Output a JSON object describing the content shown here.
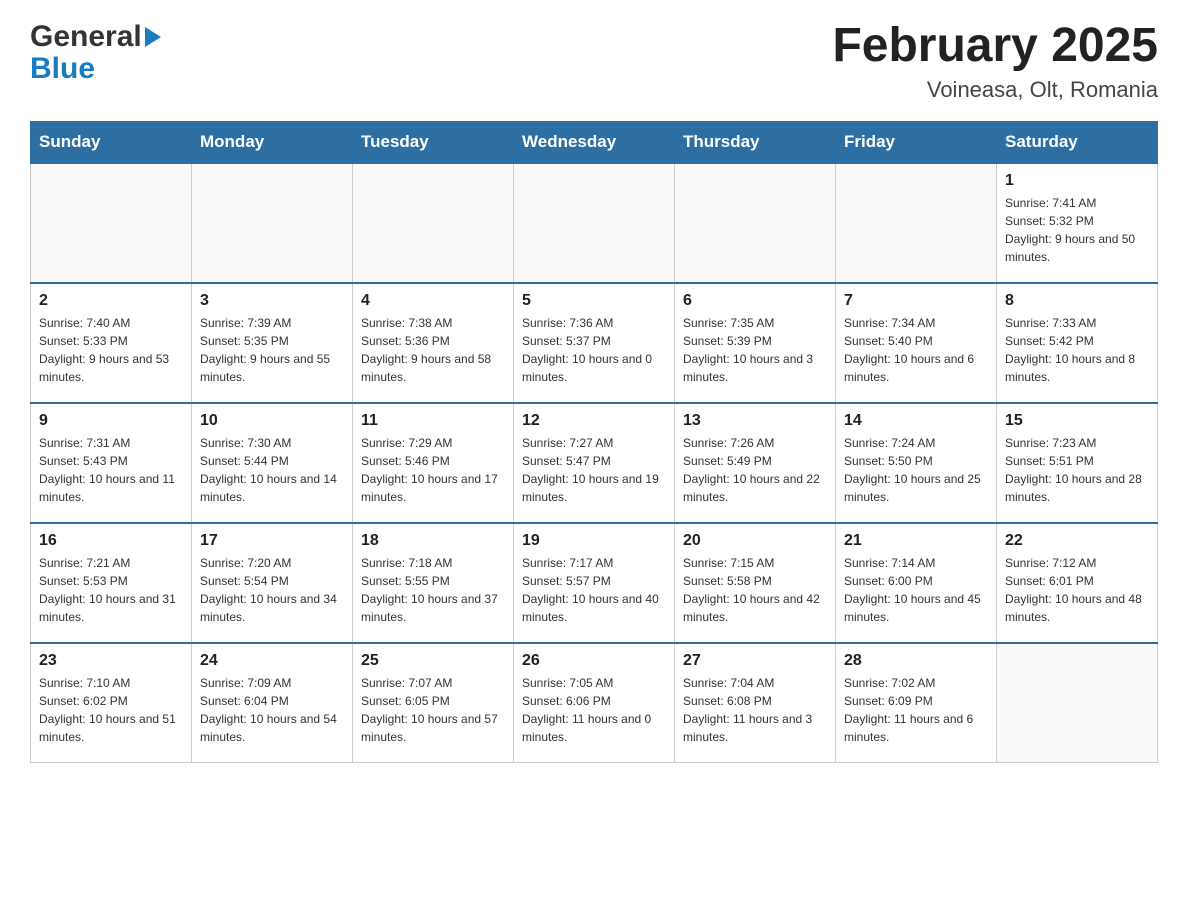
{
  "header": {
    "logo_general": "General",
    "logo_blue": "Blue",
    "title": "February 2025",
    "subtitle": "Voineasa, Olt, Romania"
  },
  "days_of_week": [
    "Sunday",
    "Monday",
    "Tuesday",
    "Wednesday",
    "Thursday",
    "Friday",
    "Saturday"
  ],
  "weeks": [
    [
      {
        "day": "",
        "info": ""
      },
      {
        "day": "",
        "info": ""
      },
      {
        "day": "",
        "info": ""
      },
      {
        "day": "",
        "info": ""
      },
      {
        "day": "",
        "info": ""
      },
      {
        "day": "",
        "info": ""
      },
      {
        "day": "1",
        "info": "Sunrise: 7:41 AM\nSunset: 5:32 PM\nDaylight: 9 hours and 50 minutes."
      }
    ],
    [
      {
        "day": "2",
        "info": "Sunrise: 7:40 AM\nSunset: 5:33 PM\nDaylight: 9 hours and 53 minutes."
      },
      {
        "day": "3",
        "info": "Sunrise: 7:39 AM\nSunset: 5:35 PM\nDaylight: 9 hours and 55 minutes."
      },
      {
        "day": "4",
        "info": "Sunrise: 7:38 AM\nSunset: 5:36 PM\nDaylight: 9 hours and 58 minutes."
      },
      {
        "day": "5",
        "info": "Sunrise: 7:36 AM\nSunset: 5:37 PM\nDaylight: 10 hours and 0 minutes."
      },
      {
        "day": "6",
        "info": "Sunrise: 7:35 AM\nSunset: 5:39 PM\nDaylight: 10 hours and 3 minutes."
      },
      {
        "day": "7",
        "info": "Sunrise: 7:34 AM\nSunset: 5:40 PM\nDaylight: 10 hours and 6 minutes."
      },
      {
        "day": "8",
        "info": "Sunrise: 7:33 AM\nSunset: 5:42 PM\nDaylight: 10 hours and 8 minutes."
      }
    ],
    [
      {
        "day": "9",
        "info": "Sunrise: 7:31 AM\nSunset: 5:43 PM\nDaylight: 10 hours and 11 minutes."
      },
      {
        "day": "10",
        "info": "Sunrise: 7:30 AM\nSunset: 5:44 PM\nDaylight: 10 hours and 14 minutes."
      },
      {
        "day": "11",
        "info": "Sunrise: 7:29 AM\nSunset: 5:46 PM\nDaylight: 10 hours and 17 minutes."
      },
      {
        "day": "12",
        "info": "Sunrise: 7:27 AM\nSunset: 5:47 PM\nDaylight: 10 hours and 19 minutes."
      },
      {
        "day": "13",
        "info": "Sunrise: 7:26 AM\nSunset: 5:49 PM\nDaylight: 10 hours and 22 minutes."
      },
      {
        "day": "14",
        "info": "Sunrise: 7:24 AM\nSunset: 5:50 PM\nDaylight: 10 hours and 25 minutes."
      },
      {
        "day": "15",
        "info": "Sunrise: 7:23 AM\nSunset: 5:51 PM\nDaylight: 10 hours and 28 minutes."
      }
    ],
    [
      {
        "day": "16",
        "info": "Sunrise: 7:21 AM\nSunset: 5:53 PM\nDaylight: 10 hours and 31 minutes."
      },
      {
        "day": "17",
        "info": "Sunrise: 7:20 AM\nSunset: 5:54 PM\nDaylight: 10 hours and 34 minutes."
      },
      {
        "day": "18",
        "info": "Sunrise: 7:18 AM\nSunset: 5:55 PM\nDaylight: 10 hours and 37 minutes."
      },
      {
        "day": "19",
        "info": "Sunrise: 7:17 AM\nSunset: 5:57 PM\nDaylight: 10 hours and 40 minutes."
      },
      {
        "day": "20",
        "info": "Sunrise: 7:15 AM\nSunset: 5:58 PM\nDaylight: 10 hours and 42 minutes."
      },
      {
        "day": "21",
        "info": "Sunrise: 7:14 AM\nSunset: 6:00 PM\nDaylight: 10 hours and 45 minutes."
      },
      {
        "day": "22",
        "info": "Sunrise: 7:12 AM\nSunset: 6:01 PM\nDaylight: 10 hours and 48 minutes."
      }
    ],
    [
      {
        "day": "23",
        "info": "Sunrise: 7:10 AM\nSunset: 6:02 PM\nDaylight: 10 hours and 51 minutes."
      },
      {
        "day": "24",
        "info": "Sunrise: 7:09 AM\nSunset: 6:04 PM\nDaylight: 10 hours and 54 minutes."
      },
      {
        "day": "25",
        "info": "Sunrise: 7:07 AM\nSunset: 6:05 PM\nDaylight: 10 hours and 57 minutes."
      },
      {
        "day": "26",
        "info": "Sunrise: 7:05 AM\nSunset: 6:06 PM\nDaylight: 11 hours and 0 minutes."
      },
      {
        "day": "27",
        "info": "Sunrise: 7:04 AM\nSunset: 6:08 PM\nDaylight: 11 hours and 3 minutes."
      },
      {
        "day": "28",
        "info": "Sunrise: 7:02 AM\nSunset: 6:09 PM\nDaylight: 11 hours and 6 minutes."
      },
      {
        "day": "",
        "info": ""
      }
    ]
  ]
}
